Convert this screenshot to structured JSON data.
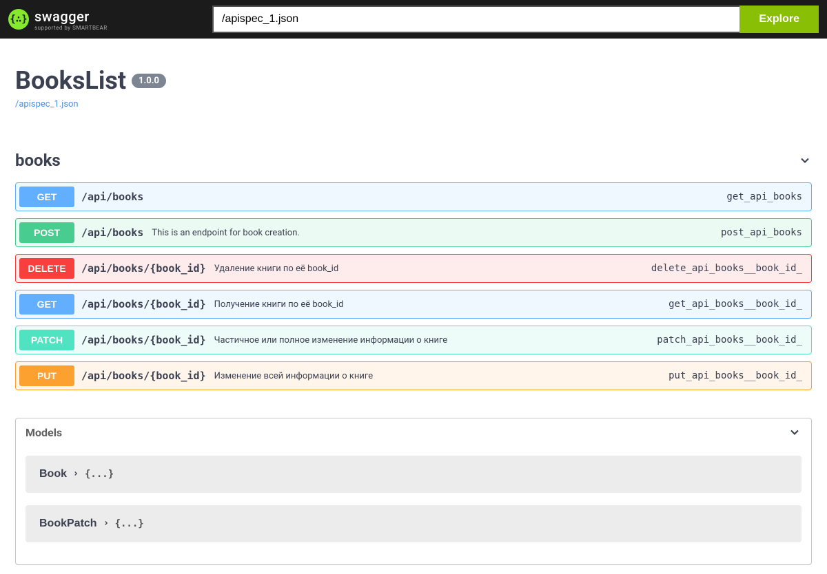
{
  "topbar": {
    "logo_text": "swagger",
    "logo_sub": "supported by SMARTBEAR",
    "search_value": "/apispec_1.json",
    "explore_label": "Explore"
  },
  "info": {
    "title": "BooksList",
    "version": "1.0.0",
    "spec_url": "/apispec_1.json"
  },
  "tag": {
    "name": "books"
  },
  "operations": [
    {
      "method": "GET",
      "class": "get-block",
      "path": "/api/books",
      "desc": "",
      "op_id": "get_api_books"
    },
    {
      "method": "POST",
      "class": "post-block",
      "path": "/api/books",
      "desc": "This is an endpoint for book creation.",
      "op_id": "post_api_books"
    },
    {
      "method": "DELETE",
      "class": "delete-block",
      "path": "/api/books/{book_id}",
      "desc": "Удаление книги по её book_id",
      "op_id": "delete_api_books__book_id_"
    },
    {
      "method": "GET",
      "class": "get-block",
      "path": "/api/books/{book_id}",
      "desc": "Получение книги по её book_id",
      "op_id": "get_api_books__book_id_"
    },
    {
      "method": "PATCH",
      "class": "patch-block",
      "path": "/api/books/{book_id}",
      "desc": "Частичное или полное изменение информации о книге",
      "op_id": "patch_api_books__book_id_"
    },
    {
      "method": "PUT",
      "class": "put-block",
      "path": "/api/books/{book_id}",
      "desc": "Изменение всей информации о книге",
      "op_id": "put_api_books__book_id_"
    }
  ],
  "models": {
    "title": "Models",
    "items": [
      {
        "name": "Book",
        "preview": "{...}"
      },
      {
        "name": "BookPatch",
        "preview": "{...}"
      }
    ]
  }
}
